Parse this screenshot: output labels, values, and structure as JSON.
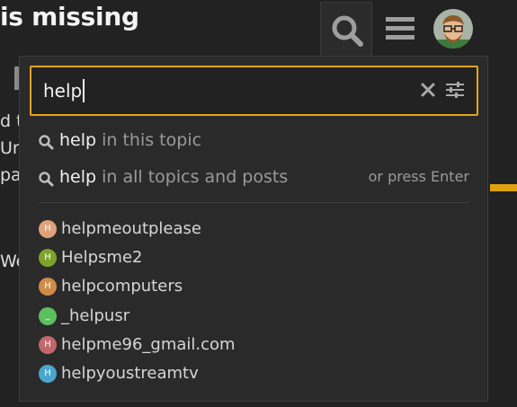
{
  "header": {
    "title": "is missing"
  },
  "background": {
    "line1": "d t",
    "line2": "Un",
    "line3": "pa",
    "line4": "We"
  },
  "search": {
    "query": "help",
    "clear_icon": "close-icon",
    "advanced_icon": "sliders-icon",
    "accent_color": "#e8a317"
  },
  "suggestions": [
    {
      "term": "help",
      "scope": " in this topic"
    },
    {
      "term": "help",
      "scope": " in all topics and posts",
      "hint": "or press Enter"
    }
  ],
  "users": [
    {
      "initial": "H",
      "name": "helpmeoutplease",
      "color": "#e0a27a"
    },
    {
      "initial": "H",
      "name": "Helpsme2",
      "color": "#7ea22a"
    },
    {
      "initial": "H",
      "name": "helpcomputers",
      "color": "#d18b48"
    },
    {
      "initial": "_",
      "name": "_helpusr",
      "color": "#5cc05c"
    },
    {
      "initial": "H",
      "name": "helpme96_gmail.com",
      "color": "#c2676a"
    },
    {
      "initial": "H",
      "name": "helpyoustreamtv",
      "color": "#4aa6cf"
    }
  ]
}
